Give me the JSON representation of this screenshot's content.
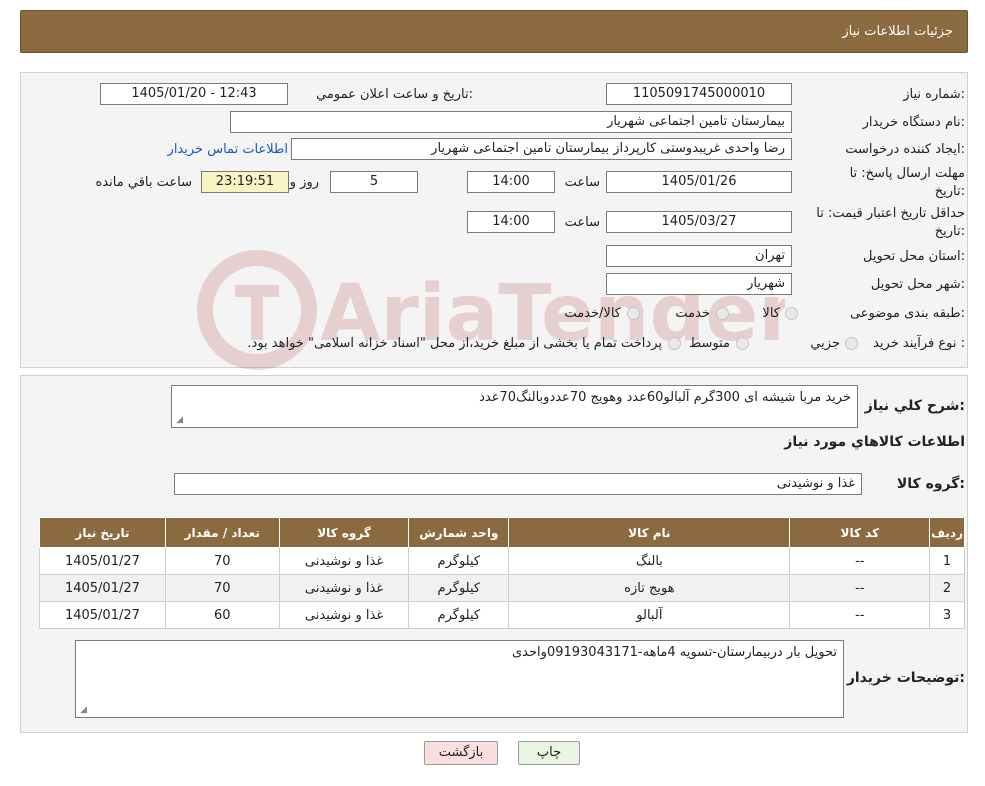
{
  "header": {
    "title": "جزئیات اطلاعات نیاز"
  },
  "form": {
    "need_number_label": "شماره نیاز:",
    "need_number": "1105091745000010",
    "announce_label": "تاریخ و ساعت اعلان عمومي:",
    "announce_value": "1405/01/20 - 12:43",
    "buyer_org_label": "نام دستگاه خريدار:",
    "buyer_org": "بیمارستان تامین اجتماعی شهریار",
    "creator_label": "ايجاد کننده درخواست:",
    "creator": "رضا واحدی غریبدوستی کارپرداز بیمارستان تامین اجتماعی شهریار",
    "contact_link": "اطلاعات تماس خریدار",
    "deadline_label_1": "مهلت ارسال پاسخ: تا",
    "deadline_label_2": "تاريخ:",
    "deadline_date": "1405/01/26",
    "time_label": "ساعت",
    "deadline_time": "14:00",
    "days_value": "5",
    "days_label": "روز و",
    "remaining_time": "23:19:51",
    "remaining_label": "ساعت باقي مانده",
    "validity_label_1": "حداقل تاريخ اعتبار قيمت: تا",
    "validity_label_2": "تاريخ:",
    "validity_date": "1405/03/27",
    "validity_time": "14:00",
    "province_label": "استان محل تحويل:",
    "province": "تهران",
    "city_label": "شهر محل تحويل:",
    "city": "شهریار",
    "category_label": "طبقه بندی موضوعی:",
    "category_options": [
      "کالا",
      "خدمت",
      "کالا/خدمت"
    ],
    "process_label": "نوع فرآيند خريد :",
    "process_options": [
      "جزیي",
      "متوسط"
    ],
    "process_note": "پرداخت تمام یا بخشی از مبلغ خرید،از محل \"اسناد خزانه اسلامی\" خواهد بود."
  },
  "description": {
    "label": "شرح کلي نياز:",
    "value": "خرید مربا شیشه ای 300گرم آلبالو60عدد وهویج 70عددوبالنگ70عدد"
  },
  "goods_section": {
    "title": "اطلاعات کالاهاي مورد نياز",
    "group_label": "گروه کالا:",
    "group_value": "غذا و نوشیدنی"
  },
  "table": {
    "headers": [
      "رديف",
      "کد کالا",
      "نام کالا",
      "واحد شمارش",
      "گروه کالا",
      "تعداد / مقدار",
      "تاريخ نياز"
    ],
    "rows": [
      [
        "1",
        "--",
        "بالنگ",
        "کیلوگرم",
        "غذا و نوشیدنی",
        "70",
        "1405/01/27"
      ],
      [
        "2",
        "--",
        "هویج تازه",
        "کیلوگرم",
        "غذا و نوشیدنی",
        "70",
        "1405/01/27"
      ],
      [
        "3",
        "--",
        "آلبالو",
        "کیلوگرم",
        "غذا و نوشیدنی",
        "60",
        "1405/01/27"
      ]
    ]
  },
  "buyer_notes": {
    "label": "توضيحات خريدار:",
    "value": "تحویل بار دربیمارستان-تسویه 4ماهه-09193043171واحدی"
  },
  "buttons": {
    "print": "چاپ",
    "back": "بازگشت"
  },
  "watermark": {
    "text": "AriaTender.neT"
  },
  "colors": {
    "header_bg": "#8b6a3f",
    "link": "#1a56c4",
    "back_btn": "#fbdede",
    "print_btn": "#e8f5e2"
  }
}
